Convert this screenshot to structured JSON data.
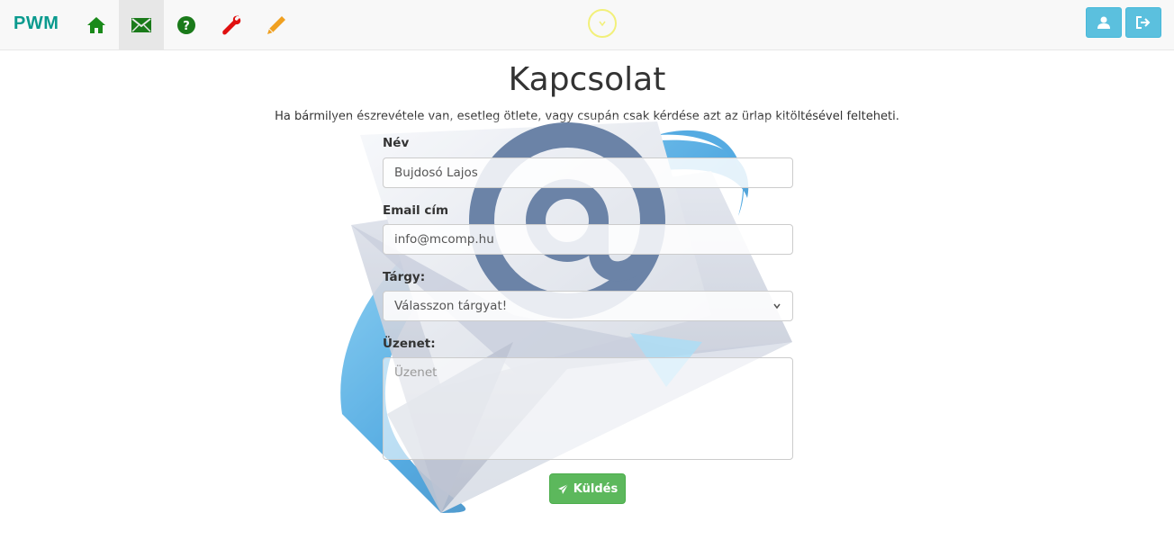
{
  "navbar": {
    "brand": "PWM",
    "items": [
      {
        "name": "home-icon",
        "color": "#1a8a1a"
      },
      {
        "name": "envelope-icon",
        "color": "#1a7a1a",
        "active": true
      },
      {
        "name": "question-circle-icon",
        "color": "#1a7a1a"
      },
      {
        "name": "wrench-icon",
        "color": "#e01010"
      },
      {
        "name": "pencil-icon",
        "color": "#f0a020"
      }
    ],
    "right_buttons": [
      {
        "name": "user-icon"
      },
      {
        "name": "logout-icon"
      }
    ]
  },
  "page": {
    "title": "Kapcsolat",
    "intro": "Ha bármilyen észrevétele van, esetleg ötlete, vagy csupán csak kérdése azt az ürlap kitöltésével felteheti."
  },
  "form": {
    "name_label": "Név",
    "name_value": "Bujdosó Lajos",
    "email_label": "Email cím",
    "email_value": "info@mcomp.hu",
    "subject_label": "Tárgy:",
    "subject_value": "Válasszon tárgyat!",
    "message_label": "Üzenet:",
    "message_placeholder": "Üzenet",
    "submit_label": "Küldés"
  },
  "colors": {
    "brand": "#0a9a8e",
    "info_button": "#5bc0de",
    "success_button": "#5cb85c"
  }
}
